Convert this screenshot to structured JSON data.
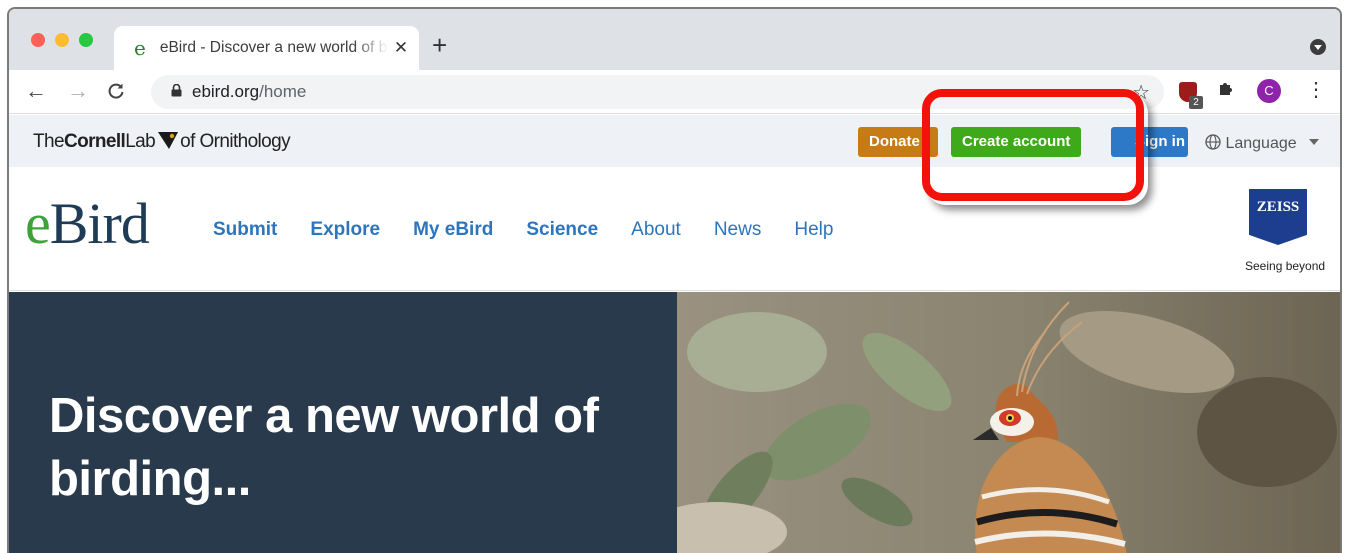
{
  "browser": {
    "tab": {
      "favicon": "e",
      "title": "eBird - Discover a new world of birding...",
      "close": "✕"
    },
    "new_tab": "+",
    "toolbar": {
      "back": "←",
      "forward": "→",
      "reload": "C"
    },
    "url": {
      "host": "ebird.org",
      "path": "/home"
    },
    "star": "☆",
    "extension_badge": "2",
    "profile_initial": "C",
    "menu": "⋮"
  },
  "cornell_bar": {
    "logo": {
      "the": "The",
      "cornell": "Cornell",
      "lab": "Lab",
      "rest": "of Ornithology"
    },
    "donate_label": "Donate",
    "create_account_label": "Create account",
    "sign_in_label": "Sign in",
    "language_label": "Language"
  },
  "site_header": {
    "logo": {
      "e": "e",
      "bird": "Bird"
    },
    "nav": {
      "submit": "Submit",
      "explore": "Explore",
      "my_ebird": "My eBird",
      "science": "Science",
      "about": "About",
      "news": "News",
      "help": "Help"
    },
    "sponsor": {
      "name": "ZEISS",
      "tagline": "Seeing beyond"
    }
  },
  "hero": {
    "title": "Discover a new world of birding..."
  },
  "colors": {
    "create_account": "#3eaa1a",
    "donate": "#c77b15",
    "sign_in": "#2d79c7",
    "hero_bg": "#2a3a4d",
    "annotation": "#f2120b"
  }
}
